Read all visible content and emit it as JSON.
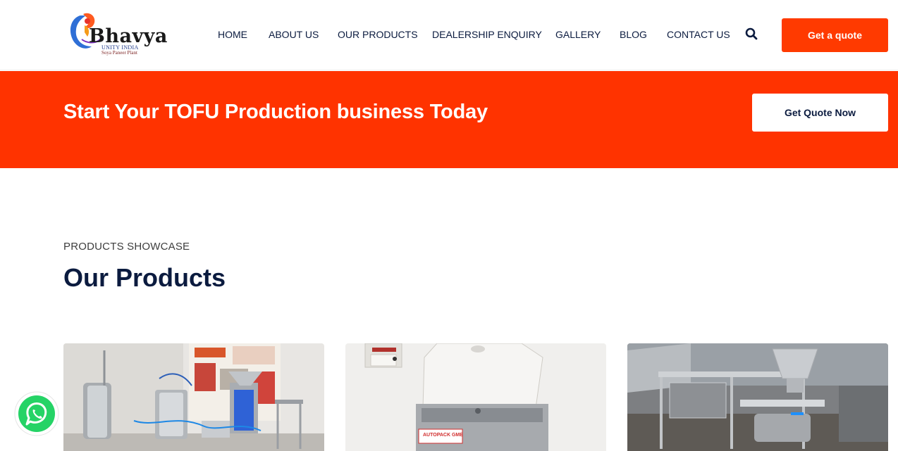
{
  "brand": {
    "name": "Bhavya",
    "sub1": "UNITY INDIA",
    "sub2": "Soya Paneer Plant",
    "accent": "#ff3300"
  },
  "nav": {
    "items": [
      {
        "label": "HOME"
      },
      {
        "label": "ABOUT US"
      },
      {
        "label": "OUR PRODUCTS"
      },
      {
        "label": "DEALERSHIP ENQUIRY"
      },
      {
        "label": "GALLERY"
      },
      {
        "label": "BLOG"
      },
      {
        "label": "CONTACT US"
      }
    ],
    "search_icon": "search-icon",
    "cta": "Get a quote"
  },
  "banner": {
    "title": "Start Your TOFU Production business Today",
    "button": "Get Quote Now"
  },
  "products": {
    "eyebrow": "PRODUCTS SHOWCASE",
    "title": "Our Products",
    "cards": [
      {
        "image": "soya-paneer-plant-photo"
      },
      {
        "image": "vacuum-packing-machine-photo",
        "label": "AUTOPACK GME"
      },
      {
        "image": "tofu-machine-photo"
      }
    ]
  },
  "floating": {
    "whatsapp_icon": "whatsapp-icon",
    "whatsapp_color": "#25d366"
  }
}
